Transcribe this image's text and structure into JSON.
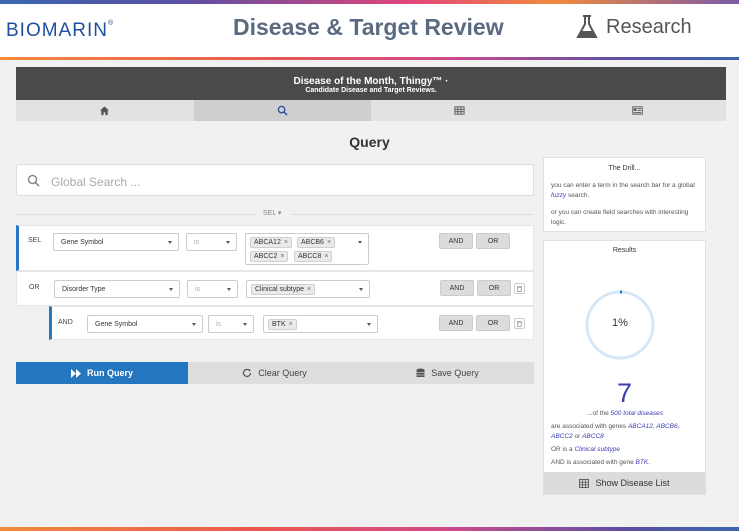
{
  "header": {
    "logo_text": "BIOMARIN",
    "logo_mark": "®",
    "title": "Disease & Target Review",
    "research_label": "Research"
  },
  "banner": {
    "line1": "Disease of the Month, Thingy™ ·",
    "line2": "Candidate Disease and Target Reviews."
  },
  "nav": {
    "tabs": [
      {
        "icon": "home-icon",
        "active": false
      },
      {
        "icon": "search-icon",
        "active": true
      },
      {
        "icon": "table-icon",
        "active": false
      },
      {
        "icon": "id-card-icon",
        "active": false
      }
    ]
  },
  "query": {
    "heading": "Query",
    "search_placeholder": "Global Search ...",
    "sel_divider": "SEL",
    "rows": [
      {
        "label": "SEL",
        "field": "Gene Symbol",
        "operator": "is",
        "values": [
          "ABCA12",
          "ABCB6",
          "ABCC2",
          "ABCC8"
        ],
        "and": "AND",
        "or": "OR"
      },
      {
        "label": "OR",
        "field": "Disorder Type",
        "operator": "is",
        "values": [
          "Clinical subtype"
        ],
        "and": "AND",
        "or": "OR"
      },
      {
        "label": "AND",
        "field": "Gene Symbol",
        "operator": "is",
        "values": [
          "BTK"
        ],
        "and": "AND",
        "or": "OR"
      }
    ],
    "run_label": "Run Query",
    "clear_label": "Clear Query",
    "save_label": "Save Query"
  },
  "drill": {
    "title": "The Drill...",
    "p1_a": "you can enter a term in the search bar for a global ",
    "p1_em": "fuzzy",
    "p1_b": " search.",
    "p2": "or you can create field searches with interesting logic."
  },
  "results": {
    "title": "Results",
    "percent_text": "1%",
    "percent_value": 1,
    "count": "7",
    "of_prefix": "...of the ",
    "of_em": "500 total diseases",
    "assoc_prefix": "are associated with genes ",
    "genes": "ABCA12, ABCB6,",
    "genes2": "ABCC2",
    "genes_or": " or ",
    "genes3": "ABCC8",
    "or_prefix": "OR is a ",
    "or_em": "Clinical subtype",
    "and_prefix": "AND is associated with gene ",
    "and_em": "BTK",
    "and_suffix": ".",
    "show_list_label": "Show Disease List"
  },
  "colors": {
    "accent": "#2477bf",
    "link": "#3b3bb5",
    "banner": "#4a4a4a"
  }
}
